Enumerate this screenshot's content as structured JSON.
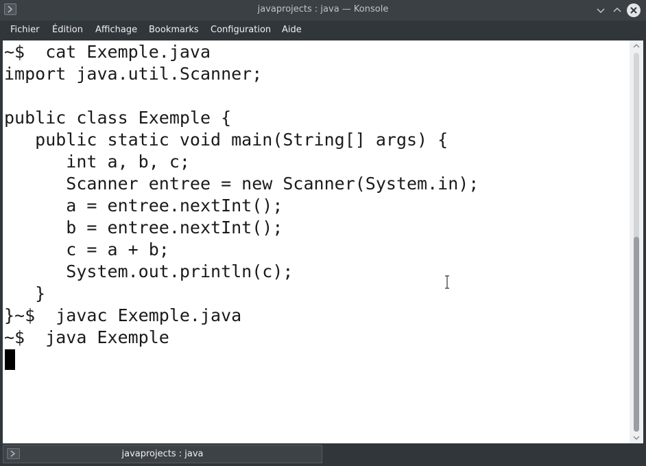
{
  "window": {
    "title": "javaprojects : java — Konsole",
    "icons": {
      "app": "terminal-prompt-icon",
      "minimize": "chevron-down-icon",
      "maximize": "chevron-up-icon",
      "close": "close-icon"
    }
  },
  "menubar": {
    "items": [
      "Fichier",
      "Édition",
      "Affichage",
      "Bookmarks",
      "Configuration",
      "Aide"
    ]
  },
  "terminal": {
    "lines": [
      "~$  cat Exemple.java",
      "import java.util.Scanner;",
      "",
      "public class Exemple {",
      "   public static void main(String[] args) {",
      "      int a, b, c;",
      "      Scanner entree = new Scanner(System.in);",
      "      a = entree.nextInt();",
      "      b = entree.nextInt();",
      "      c = a + b;",
      "      System.out.println(c);",
      "   }",
      "}~$  javac Exemple.java",
      "~$  java Exemple"
    ],
    "cursor": "block-cursor"
  },
  "tabs": [
    {
      "label": "javaprojects : java",
      "icon": "terminal-prompt-icon",
      "active": true
    }
  ],
  "colors": {
    "chrome": "#31363b",
    "terminal_bg": "#ffffff",
    "terminal_fg": "#1a1a1a",
    "close_button": "#e3e5e7"
  }
}
